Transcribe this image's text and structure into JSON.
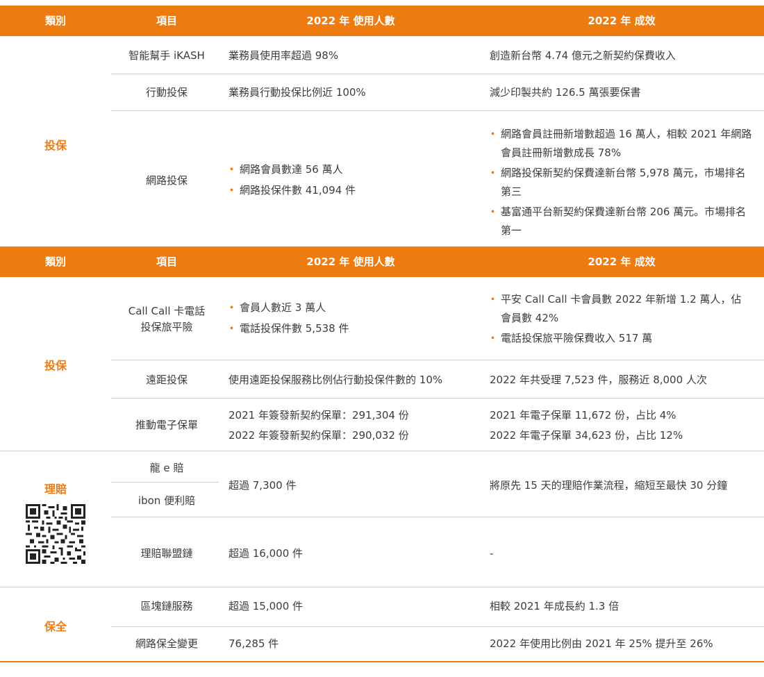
{
  "headers": {
    "category": "類別",
    "item": "項目",
    "users": "2022 年  使用人數",
    "effect": "2022 年  成效"
  },
  "section1": {
    "category": "投保",
    "rows": [
      {
        "item": "智能幫手 iKASH",
        "users": "業務員使用率超過 98%",
        "effect": "創造新台幣 4.74 億元之新契約保費收入"
      },
      {
        "item": "行動投保",
        "users": "業務員行動投保比例近 100%",
        "effect": "減少印製共約 126.5 萬張要保書"
      },
      {
        "item": "網路投保",
        "users": [
          "網路會員數達 56 萬人",
          "網路投保件數 41,094 件"
        ],
        "effect": [
          "網路會員註冊新增數超過 16 萬人，相較 2021 年網路會員註冊新增數成長 78%",
          "網路投保新契約保費達新台幣 5,978 萬元，市場排名第三",
          "基富通平台新契約保費達新台幣 206 萬元。市場排名第一"
        ]
      }
    ]
  },
  "section2": {
    "category": "投保",
    "rows": [
      {
        "item_line1": "Call Call 卡電話",
        "item_line2": "投保旅平險",
        "users": [
          "會員人數近 3 萬人",
          "電話投保件數 5,538 件"
        ],
        "effect": [
          "平安 Call Call 卡會員數 2022 年新增 1.2 萬人，佔會員數 42%",
          "電話投保旅平險保費收入 517 萬"
        ]
      },
      {
        "item": "遠距投保",
        "users": "使用遠距投保服務比例佔行動投保件數的 10%",
        "effect": "2022 年共受理 7,523 件，服務近 8,000 人次"
      },
      {
        "item": "推動電子保單",
        "users": [
          "2021 年簽發新契約保單：291,304 份",
          "2022 年簽發新契約保單：290,032 份"
        ],
        "effect": [
          "2021 年電子保單 11,672 份，占比 4%",
          "2022 年電子保單 34,623 份，占比 12%"
        ]
      }
    ]
  },
  "section3": {
    "category": "理賠",
    "rows": [
      {
        "item_a": "龍 e 賠",
        "item_b": "ibon 便利賠",
        "users": "超過 7,300 件",
        "effect": "將原先 15 天的理賠作業流程，縮短至最快 30 分鐘"
      },
      {
        "item": "理賠聯盟鏈",
        "users": "超過 16,000 件",
        "effect": "-"
      }
    ]
  },
  "section4": {
    "category": "保全",
    "rows": [
      {
        "item": "區塊鏈服務",
        "users": "超過 15,000 件",
        "effect": "相較 2021 年成長約 1.3 倍"
      },
      {
        "item": "網路保全變更",
        "users": "76,285 件",
        "effect": "2022 年使用比例由 2021 年 25% 提升至 26%"
      }
    ]
  },
  "colors": {
    "accent": "#ee7b0f",
    "divider": "#cfcfcf"
  }
}
